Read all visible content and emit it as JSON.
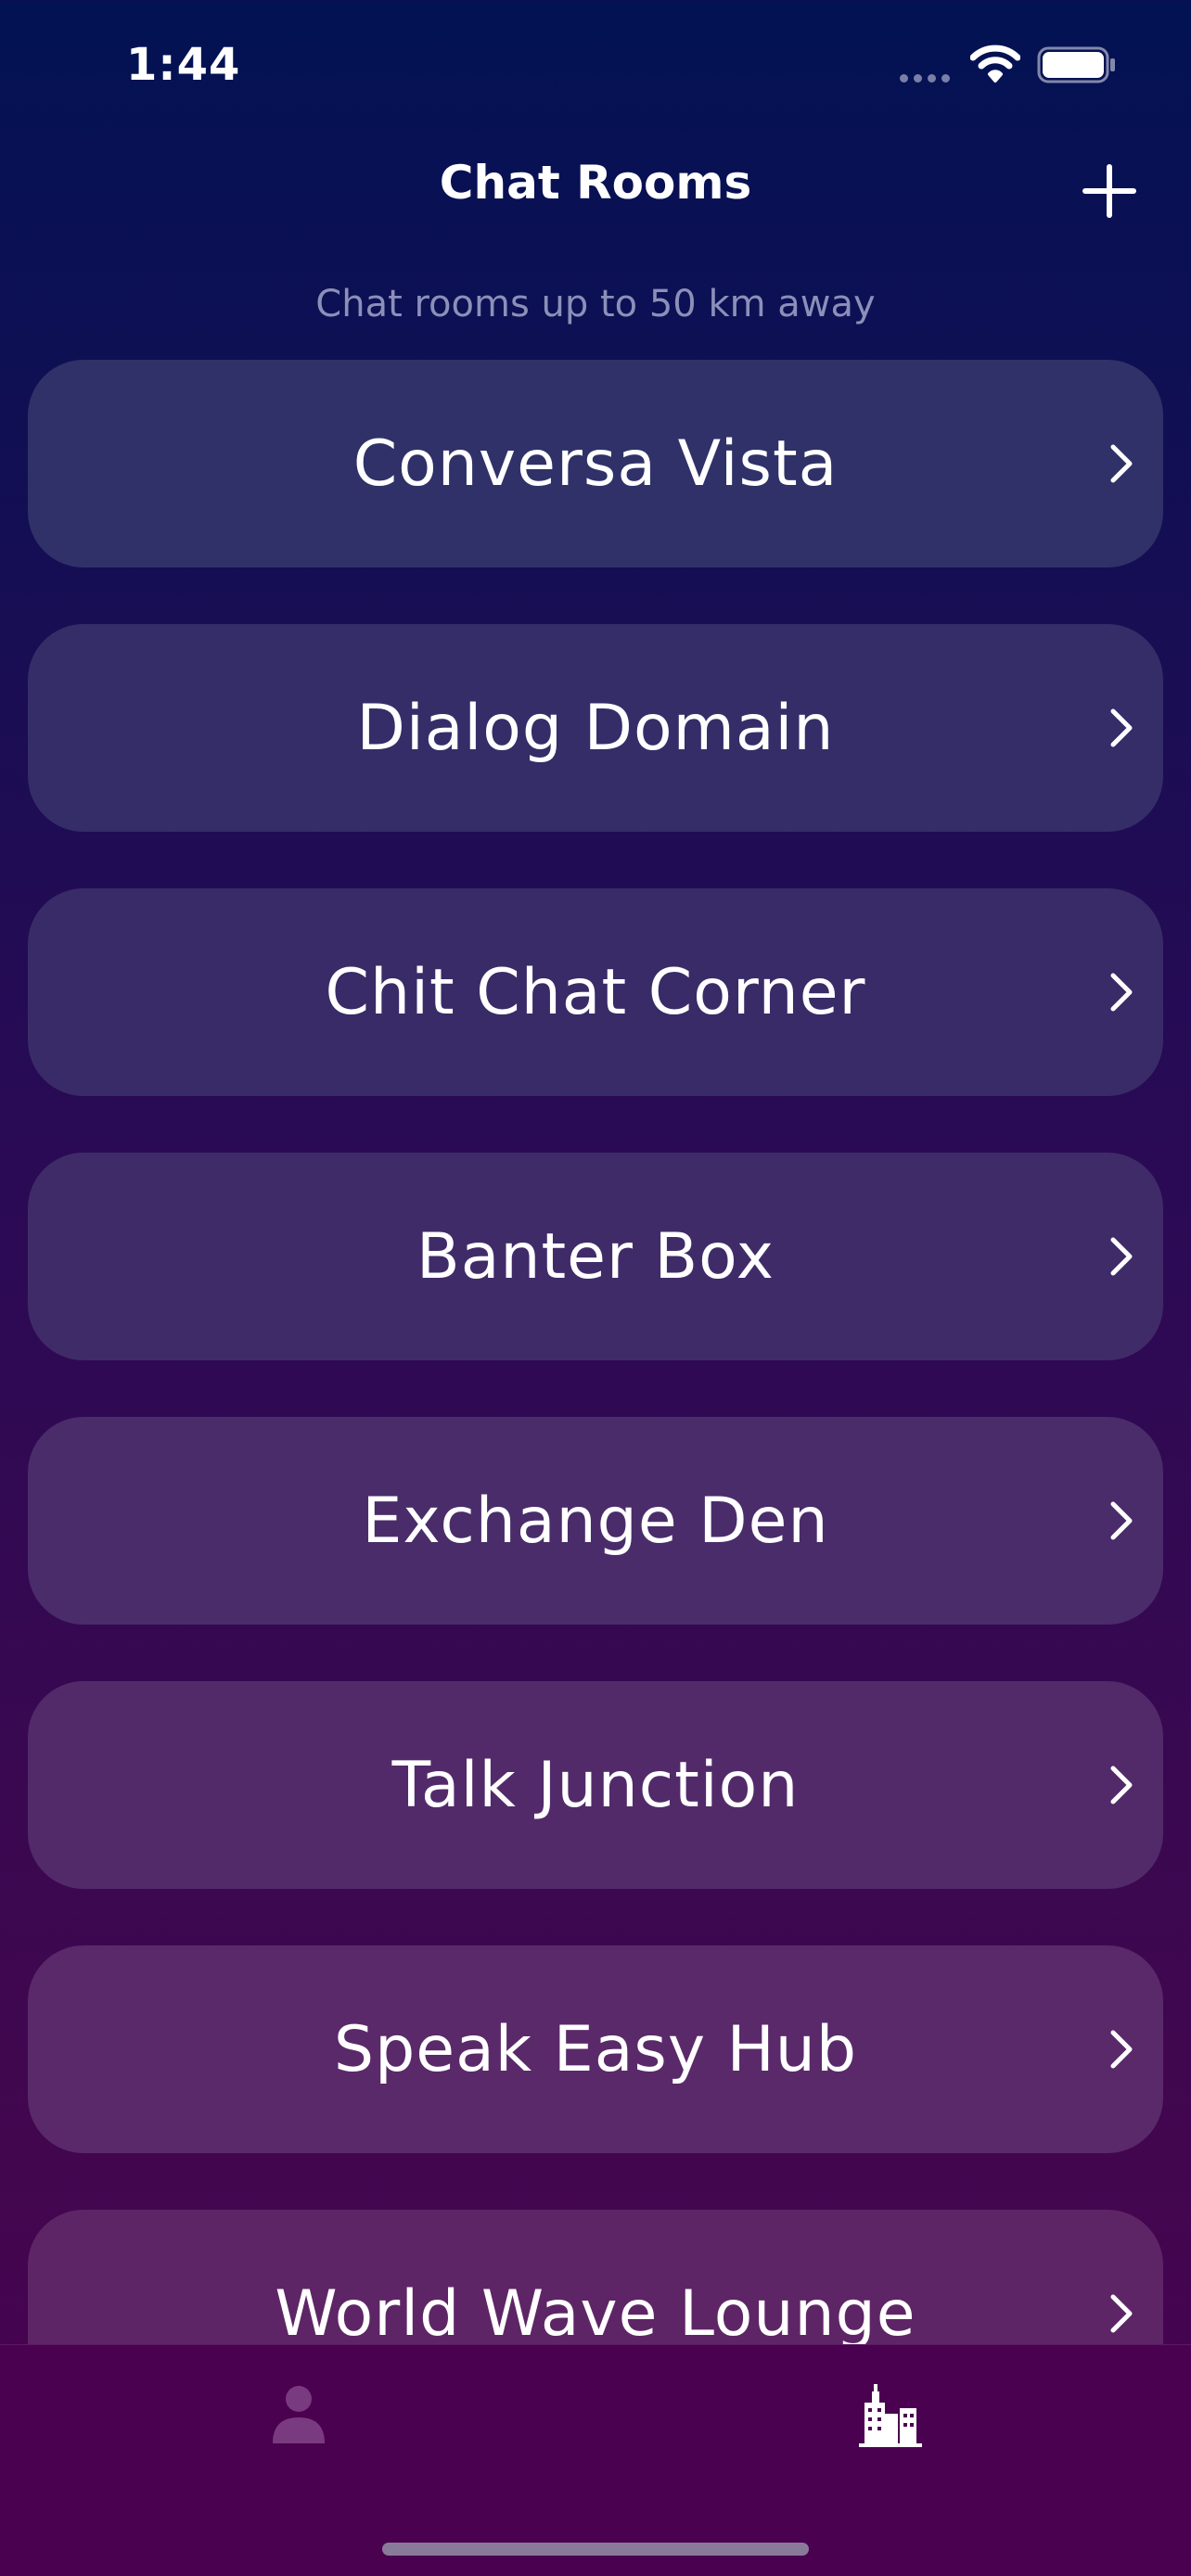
{
  "status_bar": {
    "time": "1:44",
    "icons": [
      "cellular-dots-icon",
      "wifi-icon",
      "battery-icon"
    ]
  },
  "header": {
    "title": "Chat Rooms",
    "add_icon": "plus-icon",
    "subtitle": "Chat rooms up to 50 km away"
  },
  "rooms": [
    {
      "name": "Conversa Vista",
      "color": "#2f3168"
    },
    {
      "name": "Dialog Domain",
      "color": "#342d68"
    },
    {
      "name": "Chit Chat Corner",
      "color": "#392b67"
    },
    {
      "name": "Banter Box",
      "color": "#402b69"
    },
    {
      "name": "Exchange Den",
      "color": "#4a2c6a"
    },
    {
      "name": "Talk Junction",
      "color": "#522a6a"
    },
    {
      "name": "Speak Easy Hub",
      "color": "#5a296a"
    },
    {
      "name": "World Wave Lounge",
      "color": "#5e2566"
    }
  ],
  "tab_bar": {
    "tabs": [
      {
        "icon": "person-icon",
        "active": false
      },
      {
        "icon": "city-buildings-icon",
        "active": true
      }
    ]
  },
  "colors": {
    "background_top": "#021253",
    "background_bottom": "#4a0250",
    "subtitle_text": "#8c8fb8"
  }
}
